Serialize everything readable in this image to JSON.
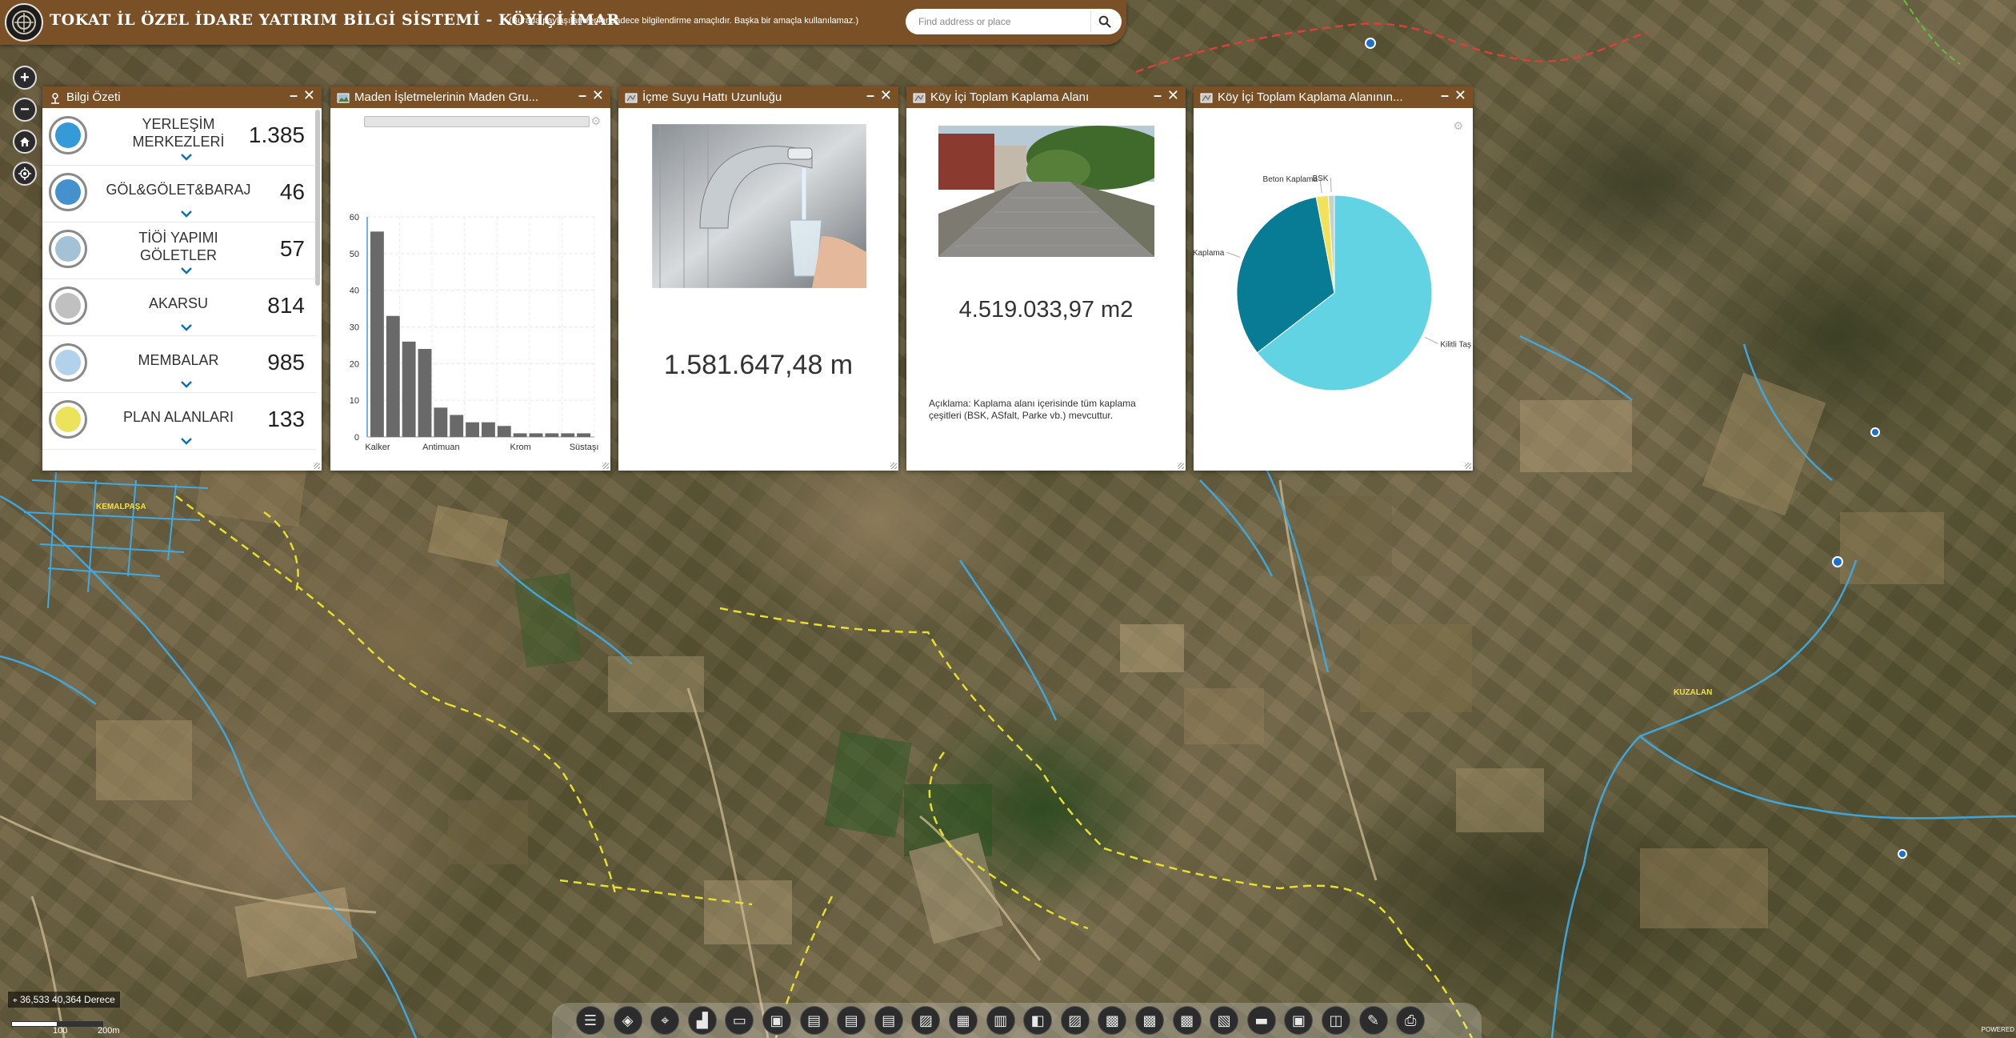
{
  "header": {
    "title": "TOKAT İL ÖZEL İDARE YATIRIM BİLGİ SİSTEMİ - KÖYİÇİ İMAR",
    "subtitle": "(Burada paylaşılan veriler sadece bilgilendirme amaçlıdır. Başka bir amaçla kullanılamaz.)",
    "search_placeholder": "Find address or place",
    "search_icon": "search-icon"
  },
  "map_controls": {
    "zoom_in": "+",
    "zoom_out": "−",
    "home_icon": "home-icon",
    "locate_icon": "locate-icon"
  },
  "map_labels": {
    "village_1": "KEMALPAŞA",
    "village_2": "KUZALAN"
  },
  "panels": {
    "bilgi": {
      "title": "Bilgi Özeti",
      "rows": [
        {
          "label": "YERLEŞİM MERKEZLERİ",
          "value": "1.385",
          "icon": "settlement-icon",
          "color": "#1f8fd4"
        },
        {
          "label": "GÖL&GÖLET&BARAJ",
          "value": "46",
          "icon": "lake-icon",
          "color": "#2f86c8"
        },
        {
          "label": "TİÖİ YAPIMI GÖLETLER",
          "value": "57",
          "icon": "pond-icon",
          "color": "#9bbad0"
        },
        {
          "label": "AKARSU",
          "value": "814",
          "icon": "river-icon",
          "color": "#b9b9b9"
        },
        {
          "label": "MEMBALAR",
          "value": "985",
          "icon": "spring-icon",
          "color": "#a9cde8"
        },
        {
          "label": "PLAN ALANLARI",
          "value": "133",
          "icon": "plan-area-icon",
          "color": "#e9e04a"
        }
      ]
    },
    "maden": {
      "title": "Maden İşletmelerinin Maden Gru...",
      "chart_data": {
        "type": "bar",
        "categories": [
          "Kalker",
          "",
          "",
          "",
          "Antimuan",
          "",
          "",
          "",
          "",
          "Krom",
          "",
          "",
          "",
          "Süstaşı"
        ],
        "category_tick_labels": [
          "Kalker",
          "Antimuan",
          "Krom",
          "Süstaşı"
        ],
        "values": [
          56,
          33,
          26,
          24,
          8,
          6,
          4,
          4,
          3,
          1,
          1,
          1,
          1,
          1
        ],
        "y_ticks": [
          "0",
          "10",
          "20",
          "30",
          "40",
          "50",
          "60"
        ],
        "ylim": [
          0,
          60
        ],
        "grid": true,
        "bar_color": "#696969",
        "title": "",
        "xlabel": "",
        "ylabel": ""
      }
    },
    "icme": {
      "title": "İçme Suyu Hattı Uzunluğu",
      "value": "1.581.647,48 m",
      "image": "water-faucet-photo"
    },
    "kaplama": {
      "title": "Köy İçi Toplam Kaplama Alanı",
      "value": "4.519.033,97 m2",
      "note": "Açıklama: Kaplama alanı içerisinde tüm kaplama çeşitleri (BSK, ASfalt, Parke vb.) mevcuttur.",
      "image": "paved-road-photo"
    },
    "kaplama_pie": {
      "title": "Köy İçi Toplam Kaplama Alanının...",
      "chart_data": {
        "type": "pie",
        "labels": [
          "Kilitli Taş",
          "Kaplama",
          "Beton Kaplama",
          "BSK"
        ],
        "values": [
          64.5,
          32.5,
          2,
          1
        ],
        "colors": [
          "#62d3e3",
          "#087c95",
          "#f2e25a",
          "#c9d0c7"
        ]
      }
    }
  },
  "status": {
    "coordinates": "36,533 40,364 Derece",
    "scale_1": "100",
    "scale_2": "200m"
  },
  "toolbar": {
    "icons": [
      "list-icon",
      "layers-icon",
      "location-icon",
      "chart-icon",
      "chat-icon",
      "screen-icon",
      "map-icon",
      "map-icon",
      "map-icon",
      "image-icon",
      "grid-icon",
      "bus-icon",
      "truck-icon",
      "image-icon",
      "building-icon",
      "building-icon",
      "building-icon",
      "road-icon",
      "folder-icon",
      "monitor-icon",
      "package-icon",
      "edit-icon",
      "print-icon"
    ]
  },
  "colors": {
    "header_brown": "#7a5126",
    "panel_header": "#7a5126",
    "stream_blue": "#3fa9e3",
    "boundary_yellow": "#e8e33a"
  }
}
